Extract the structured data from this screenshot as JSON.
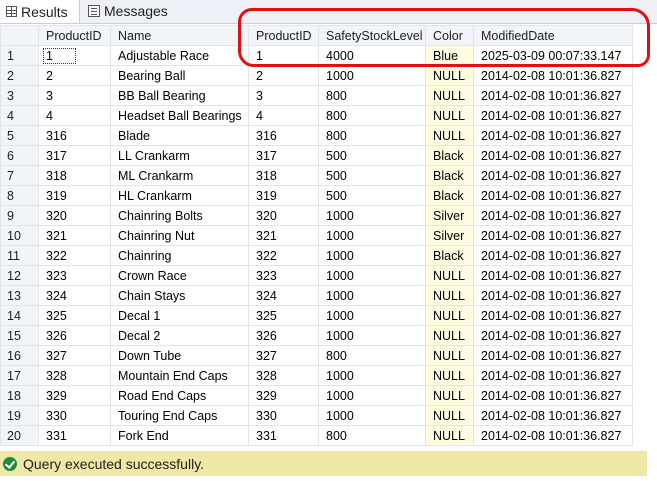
{
  "tabs": [
    {
      "label": "Results",
      "icon": "grid-icon",
      "active": true
    },
    {
      "label": "Messages",
      "icon": "messages-icon",
      "active": false
    }
  ],
  "grid": {
    "columns": [
      "ProductID",
      "Name",
      "ProductID",
      "SafetyStockLevel",
      "Color",
      "ModifiedDate"
    ],
    "rows": [
      [
        "1",
        "1",
        "Adjustable Race",
        "1",
        "4000",
        "Blue",
        "2025-03-09 00:07:33.147"
      ],
      [
        "2",
        "2",
        "Bearing Ball",
        "2",
        "1000",
        "NULL",
        "2014-02-08 10:01:36.827"
      ],
      [
        "3",
        "3",
        "BB Ball Bearing",
        "3",
        "800",
        "NULL",
        "2014-02-08 10:01:36.827"
      ],
      [
        "4",
        "4",
        "Headset Ball Bearings",
        "4",
        "800",
        "NULL",
        "2014-02-08 10:01:36.827"
      ],
      [
        "5",
        "316",
        "Blade",
        "316",
        "800",
        "NULL",
        "2014-02-08 10:01:36.827"
      ],
      [
        "6",
        "317",
        "LL Crankarm",
        "317",
        "500",
        "Black",
        "2014-02-08 10:01:36.827"
      ],
      [
        "7",
        "318",
        "ML Crankarm",
        "318",
        "500",
        "Black",
        "2014-02-08 10:01:36.827"
      ],
      [
        "8",
        "319",
        "HL Crankarm",
        "319",
        "500",
        "Black",
        "2014-02-08 10:01:36.827"
      ],
      [
        "9",
        "320",
        "Chainring Bolts",
        "320",
        "1000",
        "Silver",
        "2014-02-08 10:01:36.827"
      ],
      [
        "10",
        "321",
        "Chainring Nut",
        "321",
        "1000",
        "Silver",
        "2014-02-08 10:01:36.827"
      ],
      [
        "11",
        "322",
        "Chainring",
        "322",
        "1000",
        "Black",
        "2014-02-08 10:01:36.827"
      ],
      [
        "12",
        "323",
        "Crown Race",
        "323",
        "1000",
        "NULL",
        "2014-02-08 10:01:36.827"
      ],
      [
        "13",
        "324",
        "Chain Stays",
        "324",
        "1000",
        "NULL",
        "2014-02-08 10:01:36.827"
      ],
      [
        "14",
        "325",
        "Decal 1",
        "325",
        "1000",
        "NULL",
        "2014-02-08 10:01:36.827"
      ],
      [
        "15",
        "326",
        "Decal 2",
        "326",
        "1000",
        "NULL",
        "2014-02-08 10:01:36.827"
      ],
      [
        "16",
        "327",
        "Down Tube",
        "327",
        "800",
        "NULL",
        "2014-02-08 10:01:36.827"
      ],
      [
        "17",
        "328",
        "Mountain End Caps",
        "328",
        "1000",
        "NULL",
        "2014-02-08 10:01:36.827"
      ],
      [
        "18",
        "329",
        "Road End Caps",
        "329",
        "1000",
        "NULL",
        "2014-02-08 10:01:36.827"
      ],
      [
        "19",
        "330",
        "Touring End Caps",
        "330",
        "1000",
        "NULL",
        "2014-02-08 10:01:36.827"
      ],
      [
        "20",
        "331",
        "Fork End",
        "331",
        "800",
        "NULL",
        "2014-02-08 10:01:36.827"
      ]
    ]
  },
  "status": {
    "text": "Query executed successfully.",
    "icon": "success-check-icon"
  },
  "colors": {
    "annotation": "#e01010",
    "status_bg": "#efe7a6",
    "color_column_bg": "#fffde1",
    "success_icon": "#1f8a3b"
  }
}
